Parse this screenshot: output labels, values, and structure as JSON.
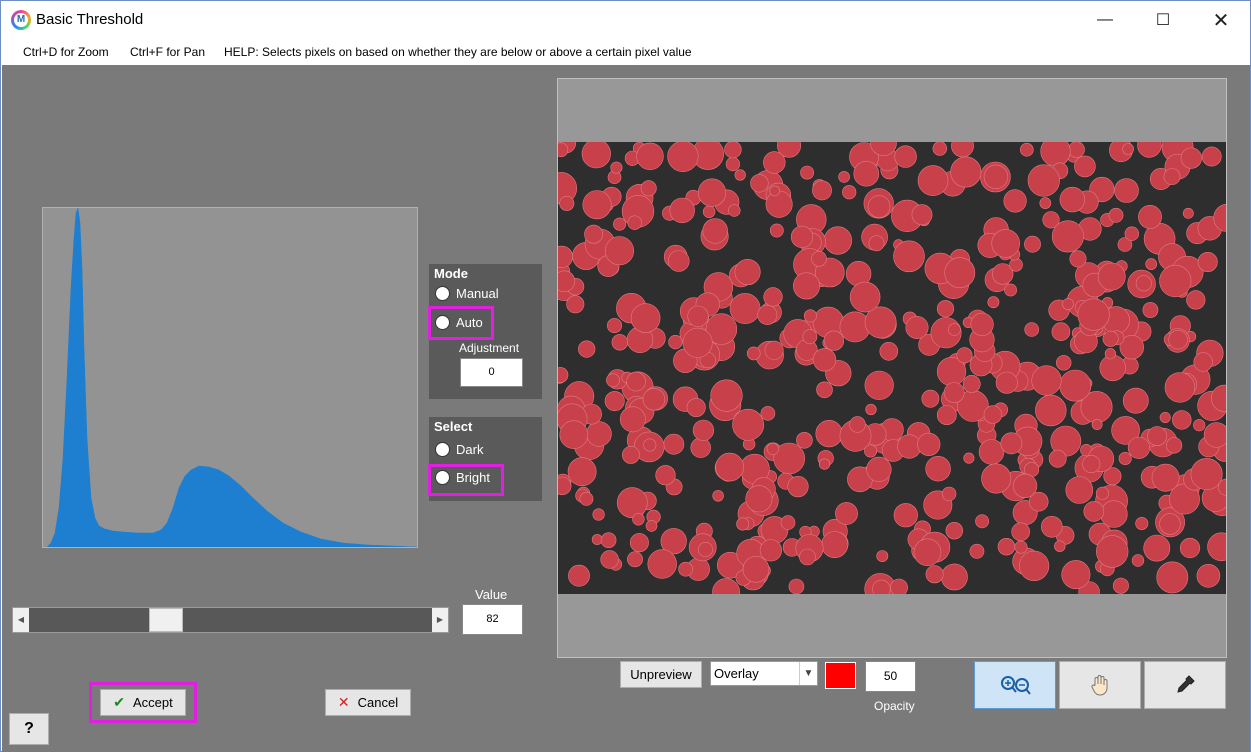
{
  "window": {
    "title": "Basic Threshold"
  },
  "menubar": {
    "zoom_hint": "Ctrl+D for Zoom",
    "pan_hint": "Ctrl+F for Pan",
    "help": "HELP:  Selects pixels on based on whether they are below or above a certain pixel value"
  },
  "mode": {
    "header": "Mode",
    "manual": "Manual",
    "auto": "Auto",
    "adjustment_label": "Adjustment",
    "adjustment_value": "0"
  },
  "select": {
    "header": "Select",
    "dark": "Dark",
    "bright": "Bright"
  },
  "threshold": {
    "value_label": "Value",
    "value": "82",
    "slider_fraction": 0.32
  },
  "buttons": {
    "accept": "Accept",
    "cancel": "Cancel",
    "help": "?",
    "unpreview": "Unpreview"
  },
  "preview": {
    "display_mode": "Overlay",
    "overlay_color": "#ff0000",
    "opacity": "50",
    "opacity_label": "Opacity"
  },
  "colors": {
    "histogram_bar": "#1e7fd0",
    "highlight": "#e020e0",
    "particle": "#c8404a"
  },
  "icons": {
    "zoom": "zoom-in-out-icon",
    "pan": "hand-pan-icon",
    "picker": "eyedropper-icon"
  }
}
